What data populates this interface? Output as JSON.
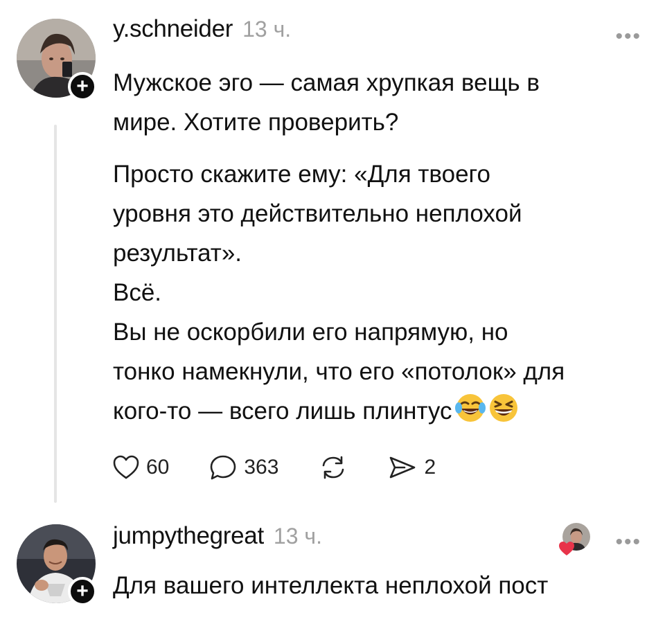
{
  "posts": [
    {
      "username": "y.schneider",
      "time": "13 ч.",
      "paragraphs": [
        "Мужское эго — самая хрупкая вещь в",
        "мире. Хотите проверить?",
        "Просто скажите ему: «Для твоего",
        "уровня это действительно неплохой",
        "результат».",
        "Всё.",
        "Вы не оскорбили его напрямую, но",
        "тонко намекнули, что его «потолок» для",
        "кого-то — всего лишь плинтус"
      ],
      "emojis": [
        "face-with-tears-of-joy-icon",
        "grinning-squinting-face-icon"
      ],
      "actions": {
        "likes": "60",
        "comments": "363",
        "shares": "2"
      }
    },
    {
      "username": "jumpythegreat",
      "time": "13 ч.",
      "text": "Для вашего интеллекта неплохой пост"
    }
  ],
  "more_label": "•••",
  "follow_label": "+",
  "colors": {
    "text": "#111111",
    "muted": "#a0a0a0",
    "thread_line": "#e5e5e5",
    "like_heart": "#e8344a"
  }
}
